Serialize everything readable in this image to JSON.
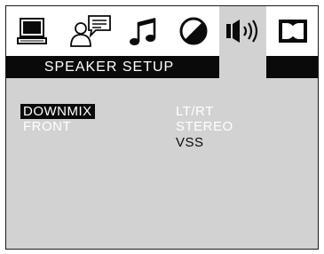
{
  "header": {
    "title": "SPEAKER SETUP",
    "tabs": [
      {
        "icon": "monitor-icon",
        "selected": false
      },
      {
        "icon": "user-language-icon",
        "selected": false
      },
      {
        "icon": "music-note-icon",
        "selected": false
      },
      {
        "icon": "picture-contrast-icon",
        "selected": false
      },
      {
        "icon": "speaker-icon",
        "selected": true
      },
      {
        "icon": "dolby-icon",
        "selected": false
      }
    ]
  },
  "menu": {
    "items": [
      {
        "label": "DOWNMIX",
        "highlighted": true
      },
      {
        "label": "FRONT",
        "highlighted": false
      }
    ],
    "options": [
      {
        "label": "LT/RT",
        "selected": false
      },
      {
        "label": "STEREO",
        "selected": false
      },
      {
        "label": "VSS",
        "selected": true
      }
    ]
  },
  "colors": {
    "background": "#ffffff",
    "panel": "#d2d2d2",
    "bar": "#0a0a0a",
    "text_light": "#ffffff",
    "text_dark": "#0a0a0a"
  }
}
